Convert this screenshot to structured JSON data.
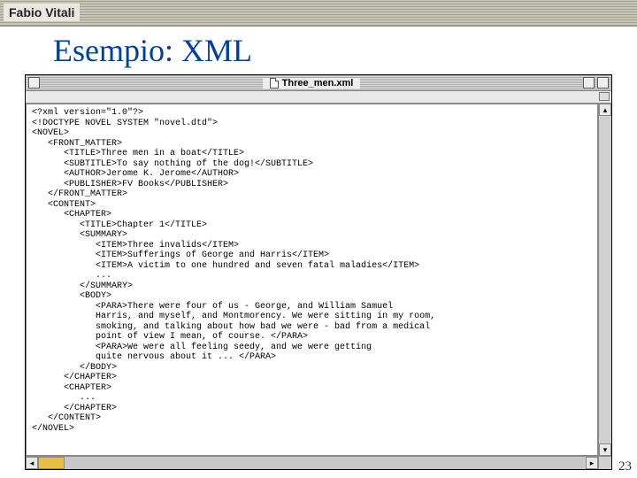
{
  "header": {
    "author": "Fabio Vitali"
  },
  "slide": {
    "title": "Esempio: XML",
    "page_number": "23"
  },
  "window": {
    "filename": "Three_men.xml"
  },
  "code": "<?xml version=\"1.0\"?>\n<!DOCTYPE NOVEL SYSTEM \"novel.dtd\">\n<NOVEL>\n   <FRONT_MATTER>\n      <TITLE>Three men in a boat</TITLE>\n      <SUBTITLE>To say nothing of the dog!</SUBTITLE>\n      <AUTHOR>Jerome K. Jerome</AUTHOR>\n      <PUBLISHER>FV Books</PUBLISHER>\n   </FRONT_MATTER>\n   <CONTENT>\n      <CHAPTER>\n         <TITLE>Chapter 1</TITLE>\n         <SUMMARY>\n            <ITEM>Three invalids</ITEM>\n            <ITEM>Sufferings of George and Harris</ITEM>\n            <ITEM>A victim to one hundred and seven fatal maladies</ITEM>\n            ...\n         </SUMMARY>\n         <BODY>\n            <PARA>There were four of us - George, and William Samuel\n            Harris, and myself, and Montmorency. We were sitting in my room,\n            smoking, and talking about how bad we were - bad from a medical\n            point of view I mean, of course. </PARA>\n            <PARA>We were all feeling seedy, and we were getting\n            quite nervous about it ... </PARA>\n         </BODY>\n      </CHAPTER>\n      <CHAPTER>\n         ...\n      </CHAPTER>\n   </CONTENT>\n</NOVEL>"
}
